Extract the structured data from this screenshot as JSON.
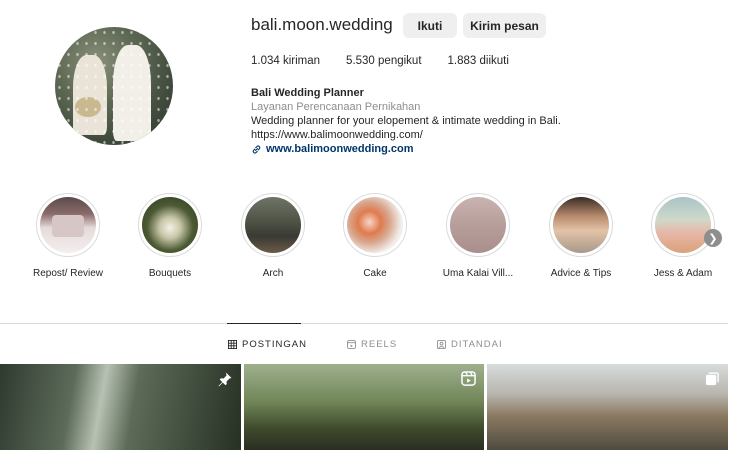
{
  "profile": {
    "username": "bali.moon.wedding",
    "follow_label": "Ikuti",
    "message_label": "Kirim pesan",
    "stats": {
      "posts_count": "1.034",
      "posts_label": "kiriman",
      "followers_count": "5.530",
      "followers_label": "pengikut",
      "following_count": "1.883",
      "following_label": "diikuti"
    },
    "bio": {
      "name": "Bali Wedding Planner",
      "category": "Layanan Perencanaan Pernikahan",
      "description": "Wedding planner for your elopement & intimate wedding in Bali.",
      "url_text": "https://www.balimoonwedding.com/",
      "link": "www.balimoonwedding.com"
    }
  },
  "highlights": [
    {
      "label": "Repost/ Review",
      "icon": "highlight-thumbnail"
    },
    {
      "label": "Bouquets",
      "icon": "highlight-thumbnail"
    },
    {
      "label": "Arch",
      "icon": "highlight-thumbnail"
    },
    {
      "label": "Cake",
      "icon": "highlight-thumbnail"
    },
    {
      "label": "Uma Kalai Vill...",
      "icon": "highlight-thumbnail"
    },
    {
      "label": "Advice & Tips",
      "icon": "highlight-thumbnail"
    },
    {
      "label": "Jess & Adam",
      "icon": "highlight-thumbnail"
    }
  ],
  "tabs": {
    "posts": "POSTINGAN",
    "reels": "REELS",
    "tagged": "DITANDAI"
  },
  "grid": [
    {
      "badge": "pin-icon"
    },
    {
      "badge": "reel-icon"
    },
    {
      "badge": "carousel-icon"
    }
  ],
  "colors": {
    "text": "#262626",
    "secondary": "#8e8e8e",
    "link": "#00376b",
    "button_bg": "#efefef",
    "border": "#dbdbdb"
  }
}
